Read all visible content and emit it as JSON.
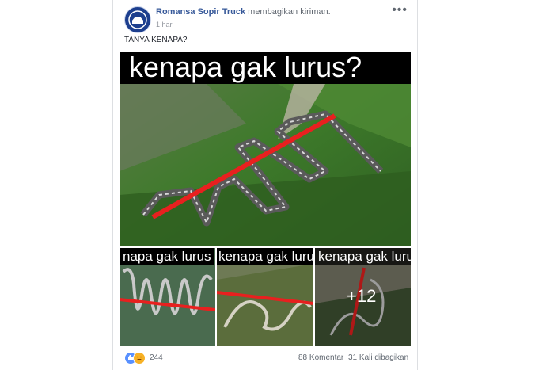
{
  "post": {
    "author_name": "Romansa Sopir Truck",
    "action_text": "membagikan kiriman.",
    "time": "1 hari",
    "text": "TANYA KENAPA?",
    "more_icon": "more-icon"
  },
  "main_image": {
    "caption": "kenapa gak lurus?"
  },
  "thumbnails": [
    {
      "caption": "napa gak lurus"
    },
    {
      "caption": "kenapa gak lurus"
    },
    {
      "caption": "kenapa gak lurus",
      "more_count": "+12"
    }
  ],
  "footer": {
    "reaction_count": "244",
    "comments": "88 Komentar",
    "shares": "31 Kali dibagikan"
  },
  "colors": {
    "author_link": "#365899",
    "meta_text": "#90949c",
    "red_line": "#e8201f",
    "like_blue": "#5890ff",
    "haha_yellow": "#f7b125"
  }
}
